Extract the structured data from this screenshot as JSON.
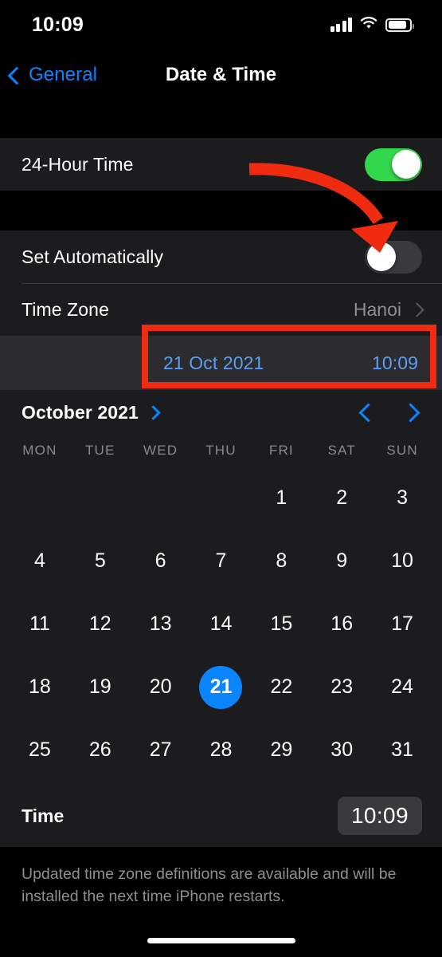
{
  "status_bar": {
    "time": "10:09",
    "signal_icon": "cellular-signal-icon",
    "wifi_icon": "wifi-icon",
    "battery_icon": "battery-icon"
  },
  "nav_bar": {
    "back_label": "General",
    "back_icon": "chevron-left-icon",
    "title": "Date & Time"
  },
  "settings": {
    "twenty_four_hour": {
      "label": "24-Hour Time",
      "toggle_state": "on"
    },
    "set_automatically": {
      "label": "Set Automatically",
      "toggle_state": "off"
    },
    "time_zone": {
      "label": "Time Zone",
      "value": "Hanoi",
      "disclosure_icon": "chevron-right-icon"
    }
  },
  "date_time_editor": {
    "date_value": "21 Oct 2021",
    "time_value": "10:09"
  },
  "calendar": {
    "month_label": "October 2021",
    "month_chevron_icon": "chevron-right-icon",
    "prev_icon": "chevron-left-icon",
    "next_icon": "chevron-right-icon",
    "weekdays": [
      "MON",
      "TUE",
      "WED",
      "THU",
      "FRI",
      "SAT",
      "SUN"
    ],
    "weeks": [
      [
        "",
        "",
        "",
        "",
        "1",
        "2",
        "3"
      ],
      [
        "4",
        "5",
        "6",
        "7",
        "8",
        "9",
        "10"
      ],
      [
        "11",
        "12",
        "13",
        "14",
        "15",
        "16",
        "17"
      ],
      [
        "18",
        "19",
        "20",
        "21",
        "22",
        "23",
        "24"
      ],
      [
        "25",
        "26",
        "27",
        "28",
        "29",
        "30",
        "31"
      ]
    ],
    "selected_day": "21"
  },
  "time_picker": {
    "label": "Time",
    "value": "10:09"
  },
  "footer": {
    "text": "Updated time zone definitions are available and will be installed the next time iPhone restarts."
  },
  "annotations": {
    "arrow_color": "#ef2b10",
    "highlight_box_color": "#ef2b10"
  },
  "colors": {
    "accent_blue": "#0a84ff",
    "toggle_on_green": "#32d74b",
    "toggle_off_gray": "#3a3a3c",
    "group_background": "#1c1c1e",
    "page_background": "#000000",
    "secondary_text": "#8e8e93"
  }
}
